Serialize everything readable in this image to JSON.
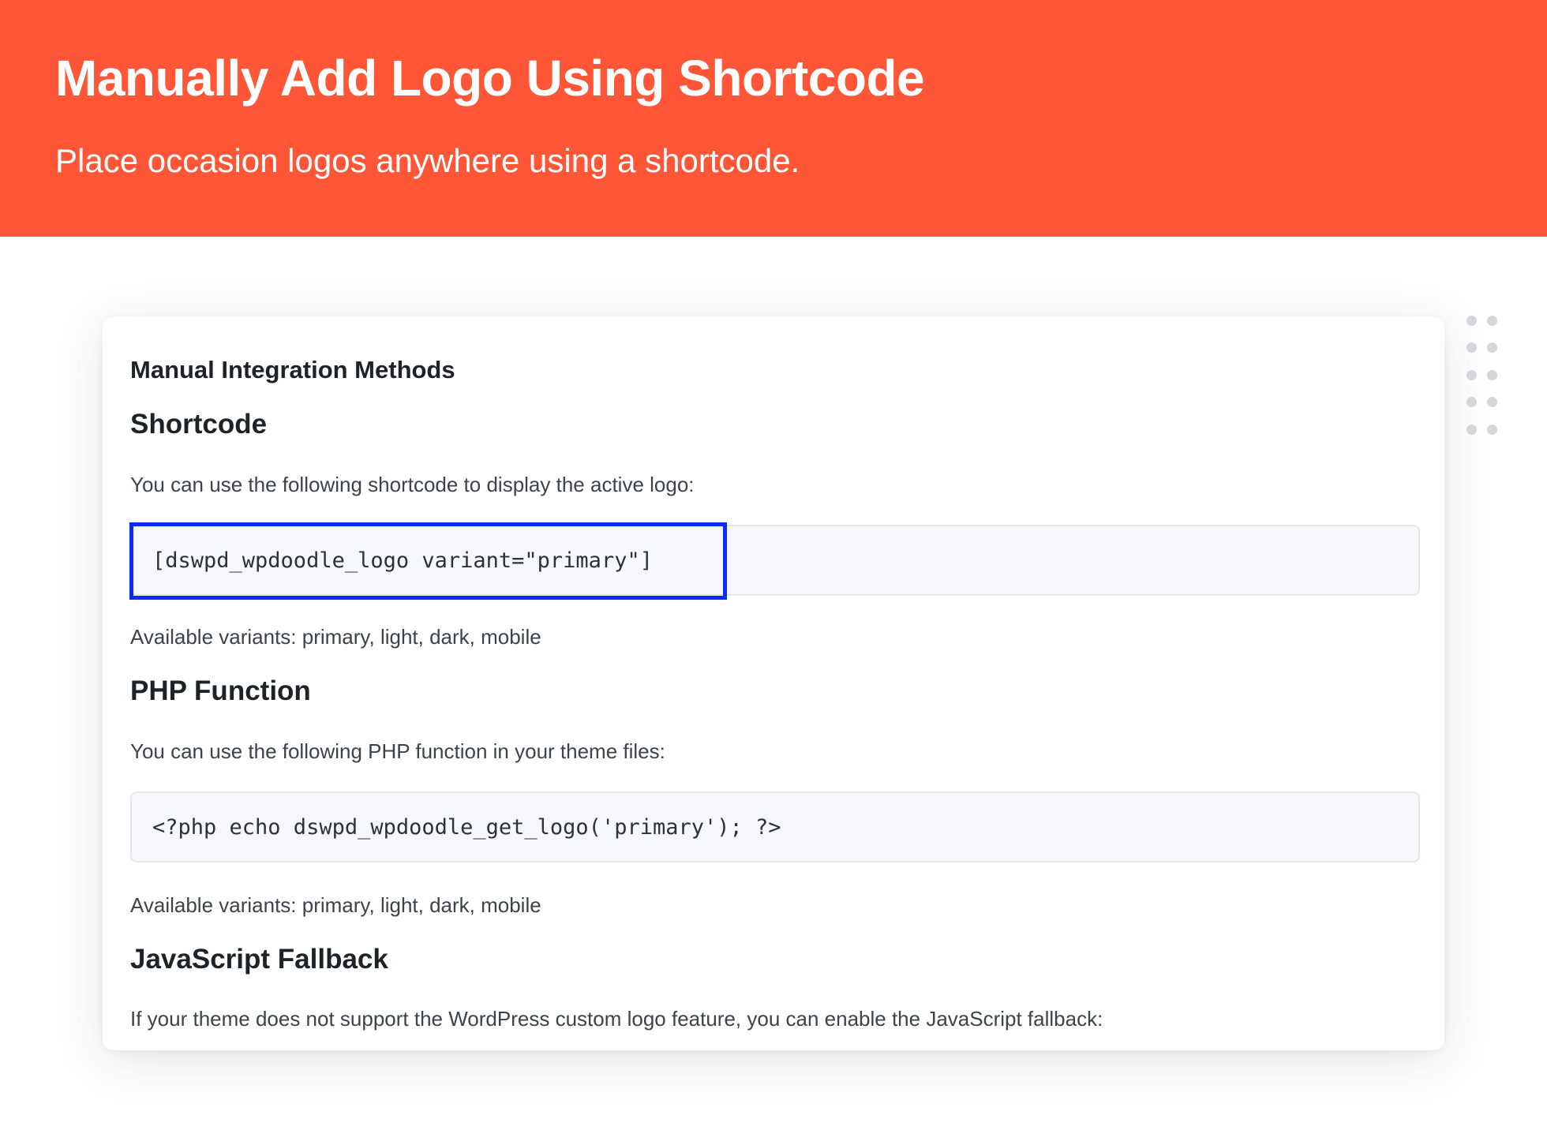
{
  "hero": {
    "title": "Manually Add Logo Using Shortcode",
    "subtitle": "Place occasion logos anywhere using a shortcode."
  },
  "colors": {
    "hero_background": "#ff5638",
    "highlight_border": "#0a2df0",
    "code_background": "#f6f7fa"
  },
  "card": {
    "heading": "Manual Integration Methods",
    "shortcode": {
      "title": "Shortcode",
      "description": "You can use the following shortcode to display the active logo:",
      "code": "[dswpd_wpdoodle_logo variant=\"primary\"]",
      "variants_note": "Available variants: primary, light, dark, mobile"
    },
    "php": {
      "title": "PHP Function",
      "description": "You can use the following PHP function in your theme files:",
      "code": "<?php echo dswpd_wpdoodle_get_logo('primary'); ?>",
      "variants_note": "Available variants: primary, light, dark, mobile"
    },
    "javascript": {
      "title": "JavaScript Fallback",
      "description": "If your theme does not support the WordPress custom logo feature, you can enable the JavaScript fallback:"
    }
  },
  "icons": {
    "drag_handle": "drag-handle-icon"
  }
}
